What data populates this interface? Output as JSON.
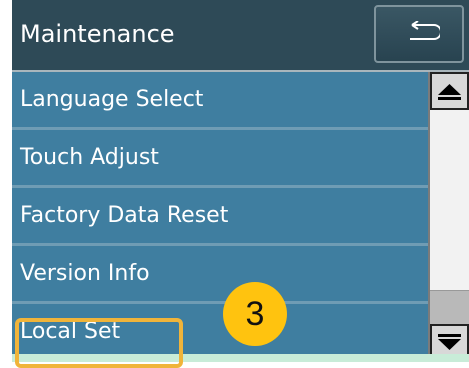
{
  "header": {
    "title": "Maintenance",
    "back_icon": "return-arrow-icon"
  },
  "menu": {
    "items": [
      {
        "label": "Language Select"
      },
      {
        "label": "Touch Adjust"
      },
      {
        "label": "Factory Data Reset"
      },
      {
        "label": "Version Info"
      },
      {
        "label": "Local Set"
      }
    ]
  },
  "scrollbar": {
    "up_icon": "triangle-up-icon",
    "down_icon": "triangle-down-icon"
  },
  "annotation": {
    "step_number": "3",
    "highlight_color": "#f0b43a",
    "badge_color": "#ffc30f"
  },
  "colors": {
    "header_bg": "#2e4a57",
    "list_bg": "#3f7ea0"
  }
}
